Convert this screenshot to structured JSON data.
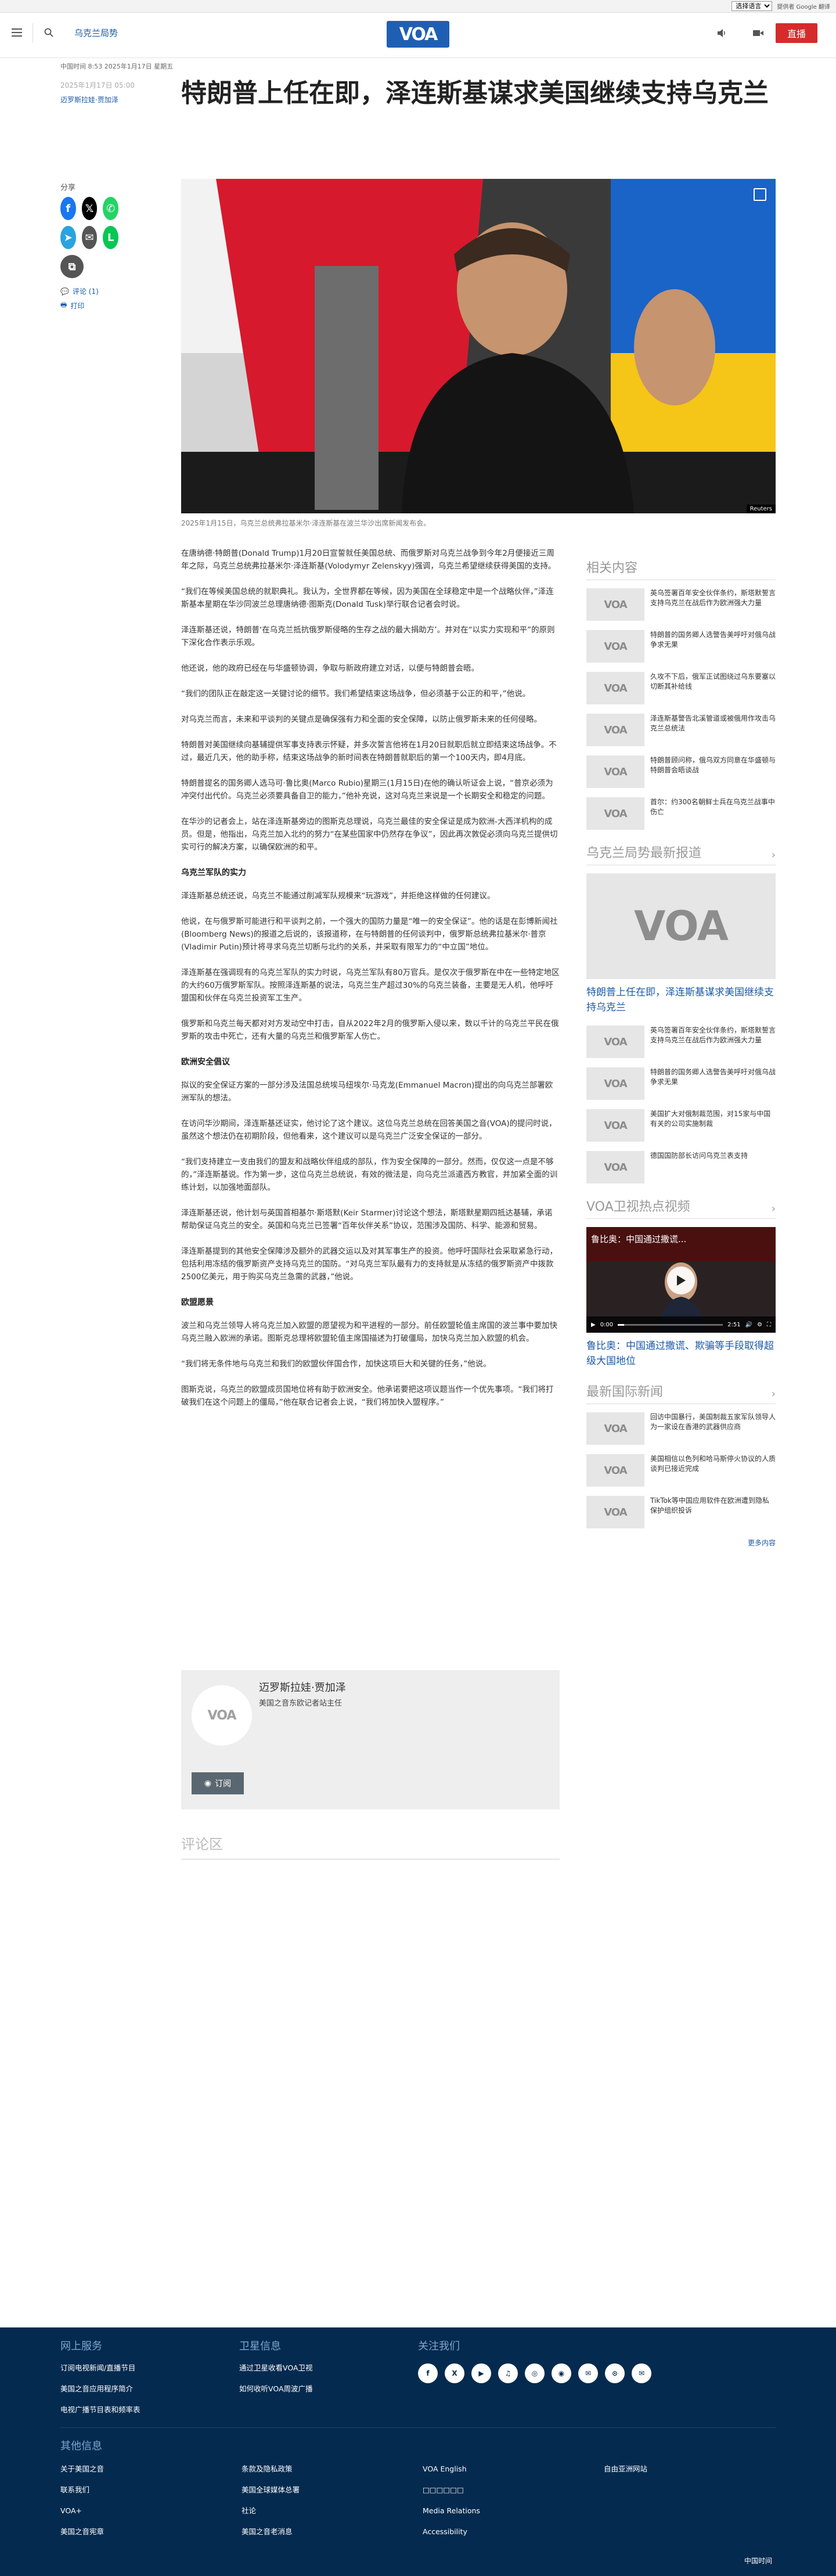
{
  "topbar": {
    "lang_select": "选择语言",
    "powered_by": "提供者 Google 翻译"
  },
  "header": {
    "section": "乌克兰局势",
    "live": "直播",
    "logo": "VOA"
  },
  "dateline": "中国时间 8:53 2025年1月17日 星期五",
  "meta": {
    "date": "2025年1月17日 05:00",
    "author": "迈罗斯拉娃·贾加泽"
  },
  "title": "特朗普上任在即，泽连斯基谋求美国继续支持乌克兰",
  "share": {
    "label": "分享",
    "comments": "评论 (1)",
    "print": "打印"
  },
  "hero": {
    "credit": "Reuters"
  },
  "caption": "2025年1月15日，乌克兰总统弗拉基米尔·泽连斯基在波兰华沙出席新闻发布会。",
  "body": [
    {
      "type": "p",
      "text": "在唐纳德·特朗普(Donald Trump)1月20日宣誓就任美国总统、而俄罗斯对乌克兰战争到今年2月便接近三周年之际，乌克兰总统弗拉基米尔·泽连斯基(Volodymyr Zelenskyy)强调，乌克兰希望继续获得美国的支持。"
    },
    {
      "type": "p",
      "text": "“我们在等候美国总统的就职典礼。我认为，全世界都在等候，因为美国在全球稳定中是一个战略伙伴，”泽连斯基本星期在华沙同波兰总理唐纳德·图斯克(Donald Tusk)举行联合记者会时说。"
    },
    {
      "type": "p",
      "text": "泽连斯基还说，特朗普‘在乌克兰抵抗俄罗斯侵略的生存之战的最大捐助方’。并对在“以实力实现和平”的原则下深化合作表示乐观。"
    },
    {
      "type": "p",
      "text": "他还说，他的政府已经在与华盛顿协调，争取与新政府建立对话，以便与特朗普会晤。"
    },
    {
      "type": "p",
      "text": "“我们的团队正在敲定这一关键讨论的细节。我们希望结束这场战争，但必须基于公正的和平，”他说。"
    },
    {
      "type": "p",
      "text": "对乌克兰而言，未来和平谈判的关键点是确保强有力和全面的安全保障，以防止俄罗斯未来的任何侵略。"
    },
    {
      "type": "p",
      "text": "特朗普对美国继续向基辅提供军事支持表示怀疑，并多次誓言他将在1月20日就职后就立即结束这场战争。不过，最近几天，他的助手称，结束这场战争的新时间表在特朗普就职后的第一个100天内，即4月底。"
    },
    {
      "type": "p",
      "text": "特朗普提名的国务卿人选马可·鲁比奥(Marco Rubio)星期三(1月15日)在他的确认听证会上说，“普京必须为冲突付出代价。乌克兰必须要具备自卫的能力，”他补充说，这对乌克兰来说是一个长期安全和稳定的问题。"
    },
    {
      "type": "p",
      "text": "在华沙的记者会上，站在泽连斯基旁边的图斯克总理说，乌克兰最佳的安全保证是成为欧洲-大西洋机构的成员。但是，他指出，乌克兰加入北约的努力“在某些国家中仍然存在争议”，因此再次敦促必须向乌克兰提供切实可行的解决方案，以确保欧洲的和平。"
    },
    {
      "type": "h",
      "text": "乌克兰军队的实力"
    },
    {
      "type": "p",
      "text": "泽连斯基总统还说，乌克兰不能通过削减军队规模来“玩游戏”，并拒绝这样做的任何建议。"
    },
    {
      "type": "p",
      "text": "他说，在与俄罗斯可能进行和平谈判之前，一个强大的国防力量是“唯一的安全保证”。他的话是在彭博新闻社(Bloomberg News)的报道之后说的，该报道称，在与特朗普的任何谈判中，俄罗斯总统弗拉基米尔·普京(Vladimir Putin)预计将寻求乌克兰切断与北约的关系，并采取有限军力的“中立国”地位。"
    },
    {
      "type": "p",
      "text": "泽连斯基在强调现有的乌克兰军队的实力时说，乌克兰军队有80万官兵。是仅次于俄罗斯在中在一些特定地区的大约60万俄罗斯军队。按照泽连斯基的说法，乌克兰生产超过30%的乌克兰装备，主要是无人机，他呼吁盟国和伙伴在乌克兰投资军工生产。"
    },
    {
      "type": "p",
      "text": "俄罗斯和乌克兰每天都对对方发动空中打击，自从2022年2月的俄罗斯入侵以来，数以千计的乌克兰平民在俄罗斯的攻击中死亡，还有大量的乌克兰和俄罗斯军人伤亡。"
    },
    {
      "type": "h",
      "text": "欧洲安全倡议"
    },
    {
      "type": "p",
      "text": "拟议的安全保证方案的一部分涉及法国总统埃马纽埃尔·马克龙(Emmanuel Macron)提出的向乌克兰部署欧洲军队的想法。"
    },
    {
      "type": "p",
      "text": "在访问华沙期间，泽连斯基还证实，他讨论了这个建议。这位乌克兰总统在回答美国之音(VOA)的提问时说，虽然这个想法仍在初期阶段，但他看来，这个建议可以是乌克兰广泛安全保证的一部分。"
    },
    {
      "type": "p",
      "text": "“我们支持建立一支由我们的盟友和战略伙伴组成的部队，作为安全保障的一部分。然而，仅仅这一点是不够的，”泽连斯基说。作为第一步，这位乌克兰总统说，有效的微法是，向乌克兰派遣西方教官，并加紧全面的训练计划，以加强地面部队。"
    },
    {
      "type": "p",
      "text": "泽连斯基还说，他计划与英国首相基尔·斯塔默(Keir Starmer)讨论这个想法，斯塔默星期四抵达基辅，承诺帮助保证乌克兰的安全。英国和乌克兰已签署“百年伙伴关系”协议，范围涉及国防、科学、能源和贸易。"
    },
    {
      "type": "p",
      "text": "泽连斯基提到的其他安全保障涉及额外的武器交运以及对其军事生产的投资。他呼吁国际社会采取紧急行动，包括利用冻结的俄罗斯资产支持乌克兰的国防。“对乌克兰军队最有力的支持就是从冻结的俄罗斯资产中拨款2500亿美元，用于购买乌克兰急需的武器，”他说。"
    },
    {
      "type": "h",
      "text": "欧盟愿景"
    },
    {
      "type": "p",
      "text": "波兰和乌克兰领导人将乌克兰加入欧盟的愿望视为和平进程的一部分。前任欧盟轮值主席国的波兰事中要加快乌克兰融入欧洲的承诺。图斯克总理将欧盟轮值主席国描述为打破僵局，加快乌克兰加入欧盟的机会。"
    },
    {
      "type": "p",
      "text": "“我们将无条件地与乌克兰和我们的欧盟伙伴国合作，加快这项巨大和关键的任务，”他说。"
    },
    {
      "type": "p",
      "text": "图斯克说，乌克兰的欧盟成员国地位将有助于欧洲安全。他承诺要把这项议题当作一个优先事项。“我们将打破我们在这个问题上的僵局，”他在联合记者会上说，“我们将加快入盟程序。”"
    }
  ],
  "authorbox": {
    "name": "迈罗斯拉娃·贾加泽",
    "role": "美国之音东欧记者站主任",
    "subscribe": "订阅"
  },
  "comments_head": "评论区",
  "sidebar": {
    "related_title": "相关内容",
    "related": [
      "英乌签署百年安全伙伴条约，斯塔默誓言支持乌克兰在战后作为欧洲强大力量",
      "特朗普的国务卿人选警告美呼吁对俄乌战争求无果",
      "久攻不下后，俄军正试图绕过乌东要塞以切断其补给线",
      "泽连斯基警告北溪管道或被俄用作攻击乌克兰总统法",
      "特朗普顾问称，俄乌双方同意在华盛顿与特朗普会晤谈战",
      "首尔：约300名朝鲜士兵在乌克兰战事中伤亡"
    ],
    "section2_title": "乌克兰局势最新报道",
    "featured": "特朗普上任在即，泽连斯基谋求美国继续支持乌克兰",
    "section2": [
      "英乌签署百年安全伙伴条约，斯塔默誓言支持乌克兰在战后作为欧洲强大力量",
      "特朗普的国务卿人选警告美呼吁对俄乌战争求无果",
      "美国扩大对俄制裁范围，对15家与中国有关的公司实施制裁",
      "德国国防部长访问乌克兰表支持"
    ],
    "section3_title": "VOA卫视热点视频",
    "video_title": "鲁比奥：中国通过撒谎...",
    "video_time": "0:00",
    "video_duration": "2:51",
    "video_progress": 0.06,
    "video_caption": "鲁比奥：中国通过撒谎、欺骗等手段取得超级大国地位",
    "section4_title": "最新国际新闻",
    "section4": [
      "回访中国暴行，美国制裁五家军队领导人为一家设在香港的武器供应商",
      "美国相信以色列和哈马斯停火协议的人质谈判已接近完成",
      "TikTok等中国应用软件在欧洲遭到隐私保护组织投诉"
    ],
    "more": "更多内容"
  },
  "footer": {
    "col1_title": "网上服务",
    "col1": [
      "订阅电视新闻/直播节目",
      "美国之音应用程序简介",
      "电视广播节目表和频率表"
    ],
    "col2_title": "卫星信息",
    "col2": [
      "通过卫星收看VOA卫视",
      "如何收听VOA周波广播"
    ],
    "col3_title": "关注我们",
    "social": [
      "f",
      "X",
      "▶",
      "♫",
      "◎",
      "◉",
      "✉",
      "⊙",
      "✉"
    ],
    "other_title": "其他信息",
    "o1": [
      "关于美国之音",
      "联系我们",
      "VOA+",
      "美国之音宪章"
    ],
    "o2": [
      "条款及隐私政策",
      "美国全球媒体总署",
      "社论",
      "美国之音老消息"
    ],
    "o3": [
      "VOA English",
      "□□□□□□",
      "Media Relations",
      "Accessibility"
    ],
    "o4": [
      "自由亚洲网站"
    ],
    "time": "中国时间"
  }
}
